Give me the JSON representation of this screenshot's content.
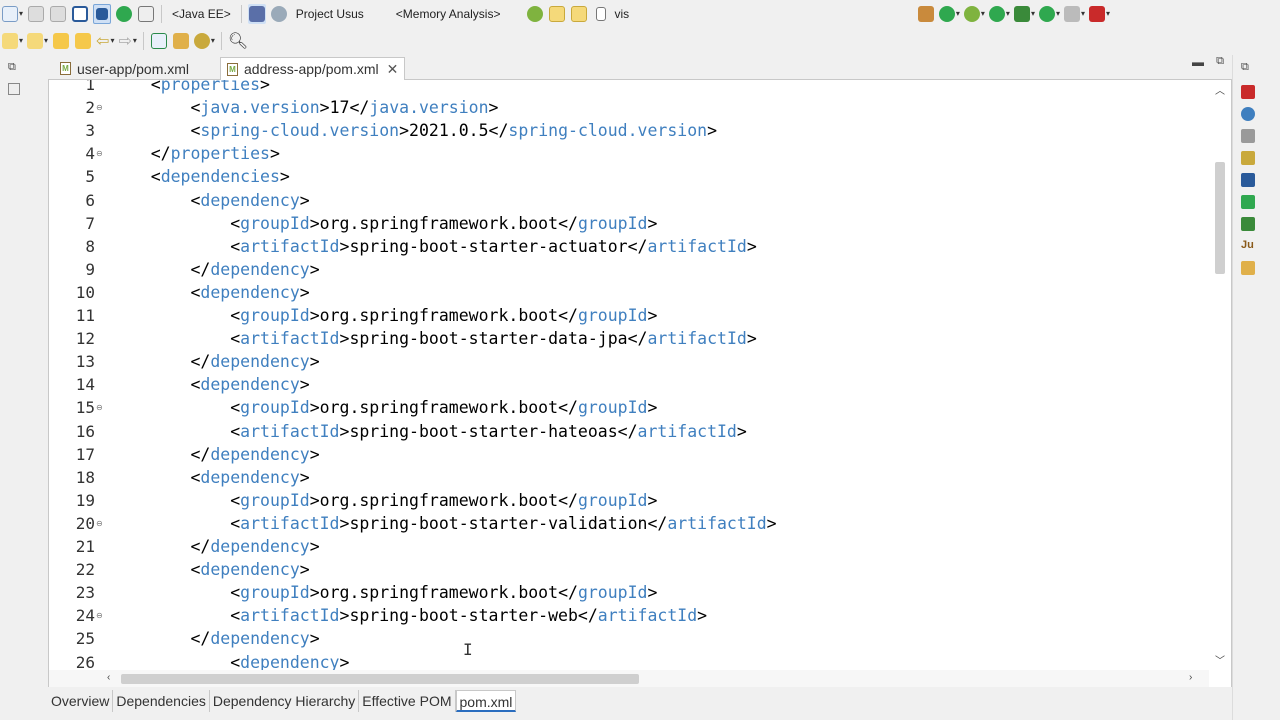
{
  "toolbar": {
    "perspective_java_ee": "<Java EE>",
    "project_label": "Project Usus",
    "memory_label": "<Memory Analysis>",
    "vis_label": "vis"
  },
  "editor_tabs": [
    {
      "label": "user-app/pom.xml",
      "active": false
    },
    {
      "label": "address-app/pom.xml",
      "active": true
    }
  ],
  "line_numbers": [
    "1",
    "2",
    "3",
    "4",
    "5",
    "6",
    "7",
    "8",
    "9",
    "10",
    "11",
    "12",
    "13",
    "14",
    "15",
    "16",
    "17",
    "18",
    "19",
    "20",
    "21",
    "22",
    "23",
    "24",
    "25",
    "26"
  ],
  "code_lines": [
    {
      "indent": "    ",
      "open": "properties",
      "text": "",
      "close": "",
      "closetag": false,
      "partial": true
    },
    {
      "indent": "        ",
      "open": "java.version",
      "text": "17",
      "close": "java.version"
    },
    {
      "indent": "        ",
      "open": "spring-cloud.version",
      "text": "2021.0.5",
      "close": "spring-cloud.version"
    },
    {
      "indent": "    ",
      "open": "",
      "text": "",
      "close": "properties"
    },
    {
      "indent": "    ",
      "open": "dependencies",
      "text": "",
      "close": ""
    },
    {
      "indent": "        ",
      "open": "dependency",
      "text": "",
      "close": ""
    },
    {
      "indent": "            ",
      "open": "groupId",
      "text": "org.springframework.boot",
      "close": "groupId"
    },
    {
      "indent": "            ",
      "open": "artifactId",
      "text": "spring-boot-starter-actuator",
      "close": "artifactId"
    },
    {
      "indent": "        ",
      "open": "",
      "text": "",
      "close": "dependency"
    },
    {
      "indent": "        ",
      "open": "dependency",
      "text": "",
      "close": ""
    },
    {
      "indent": "            ",
      "open": "groupId",
      "text": "org.springframework.boot",
      "close": "groupId"
    },
    {
      "indent": "            ",
      "open": "artifactId",
      "text": "spring-boot-starter-data-jpa",
      "close": "artifactId"
    },
    {
      "indent": "        ",
      "open": "",
      "text": "",
      "close": "dependency"
    },
    {
      "indent": "        ",
      "open": "dependency",
      "text": "",
      "close": ""
    },
    {
      "indent": "            ",
      "open": "groupId",
      "text": "org.springframework.boot",
      "close": "groupId"
    },
    {
      "indent": "            ",
      "open": "artifactId",
      "text": "spring-boot-starter-hateoas",
      "close": "artifactId"
    },
    {
      "indent": "        ",
      "open": "",
      "text": "",
      "close": "dependency"
    },
    {
      "indent": "        ",
      "open": "dependency",
      "text": "",
      "close": ""
    },
    {
      "indent": "            ",
      "open": "groupId",
      "text": "org.springframework.boot",
      "close": "groupId"
    },
    {
      "indent": "            ",
      "open": "artifactId",
      "text": "spring-boot-starter-validation",
      "close": "artifactId"
    },
    {
      "indent": "        ",
      "open": "",
      "text": "",
      "close": "dependency"
    },
    {
      "indent": "        ",
      "open": "dependency",
      "text": "",
      "close": ""
    },
    {
      "indent": "            ",
      "open": "groupId",
      "text": "org.springframework.boot",
      "close": "groupId"
    },
    {
      "indent": "            ",
      "open": "artifactId",
      "text": "spring-boot-starter-web",
      "close": "artifactId"
    },
    {
      "indent": "        ",
      "open": "",
      "text": "",
      "close": "dependency"
    },
    {
      "indent": "            ",
      "open": "dependency",
      "text": "",
      "close": ""
    }
  ],
  "fold_markers": [
    "2",
    "4",
    "15",
    "20",
    "24"
  ],
  "page_tabs": [
    {
      "label": "Overview",
      "active": false
    },
    {
      "label": "Dependencies",
      "active": false
    },
    {
      "label": "Dependency Hierarchy",
      "active": false
    },
    {
      "label": "Effective POM",
      "active": false
    },
    {
      "label": "pom.xml",
      "active": true
    }
  ],
  "colors": {
    "tag": "#3f7fbf",
    "text": "#000000",
    "accent": "#2a6dbf"
  }
}
